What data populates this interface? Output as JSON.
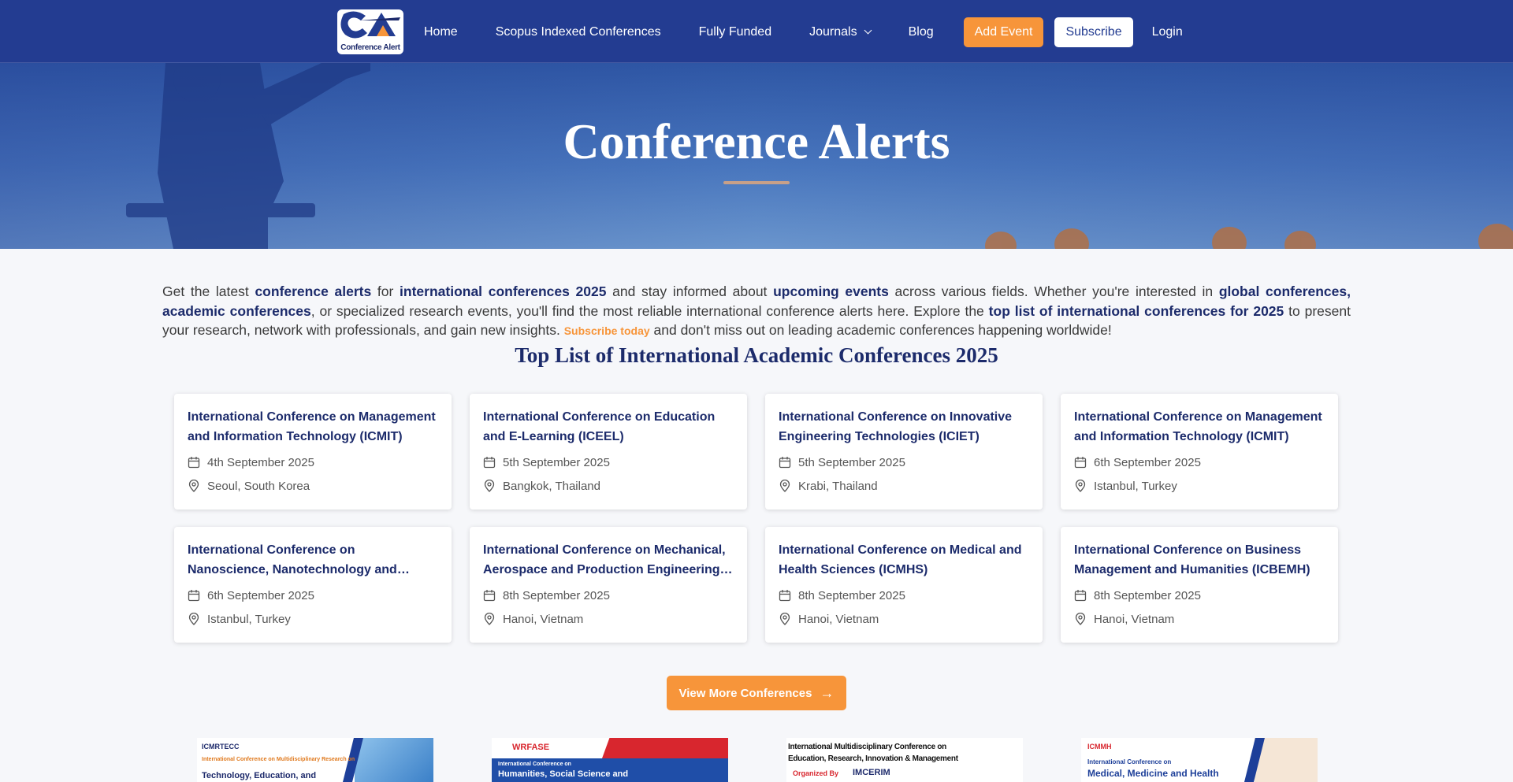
{
  "nav": {
    "logo_text": "Conference Alert",
    "links": [
      "Home",
      "Scopus Indexed Conferences",
      "Fully Funded",
      "Journals",
      "Blog"
    ],
    "add_event": "Add Event",
    "subscribe": "Subscribe",
    "login": "Login"
  },
  "hero": {
    "title": "Conference Alerts"
  },
  "intro": {
    "p1": "Get the latest ",
    "b1": "conference alerts",
    "p2": " for ",
    "b2": "international conferences 2025",
    "p3": " and stay informed about ",
    "b3": "upcoming events",
    "p4": " across various fields. Whether you're interested in ",
    "b4": "global conferences, academic conferences",
    "p5": ", or specialized research events, you'll find the most reliable international conference alerts here. Explore the ",
    "b5": "top list of international conferences for 2025",
    "p6": " to present your research, network with professionals, and gain new insights. ",
    "link": "Subscribe today",
    "p7": " and don't miss out on leading academic conferences happening worldwide!"
  },
  "section_title": "Top List of International Academic Conferences 2025",
  "conferences": [
    {
      "title": "International Conference on Management and Information Technology (ICMIT)",
      "date": "4th September 2025",
      "location": "Seoul, South Korea"
    },
    {
      "title": "International Conference on Education and E-Learning (ICEEL)",
      "date": "5th September 2025",
      "location": "Bangkok, Thailand"
    },
    {
      "title": "International Conference on Innovative Engineering Technologies (ICIET)",
      "date": "5th September 2025",
      "location": "Krabi, Thailand"
    },
    {
      "title": "International Conference on Management and Information Technology (ICMIT)",
      "date": "6th September 2025",
      "location": "Istanbul, Turkey"
    },
    {
      "title": "International Conference on Nanoscience, Nanotechnology and Advanced Materials…",
      "date": "6th September 2025",
      "location": "Istanbul, Turkey"
    },
    {
      "title": "International Conference on Mechanical, Aerospace and Production Engineering…",
      "date": "8th September 2025",
      "location": "Hanoi, Vietnam"
    },
    {
      "title": "International Conference on Medical and Health Sciences (ICMHS)",
      "date": "8th September 2025",
      "location": "Hanoi, Vietnam"
    },
    {
      "title": "International Conference on Business Management and Humanities (ICBEMH)",
      "date": "8th September 2025",
      "location": "Hanoi, Vietnam"
    }
  ],
  "view_more": "View More Conferences",
  "banners": [
    {
      "org": "ICMRTECC",
      "line1": "International Conference on Multidisciplinary Research on",
      "line2": "Technology, Education, and"
    },
    {
      "org": "WRFASE",
      "line1": "International Conference on",
      "line2": "Humanities, Social Science and"
    },
    {
      "org": "IMCERIM",
      "line1": "International Multidisciplinary Conference on",
      "line2": "Education, Research, Innovation & Management",
      "line3": "Organized By"
    },
    {
      "org": "ICMMH",
      "line1": "International Conference on",
      "line2": "Medical, Medicine and Health"
    }
  ]
}
